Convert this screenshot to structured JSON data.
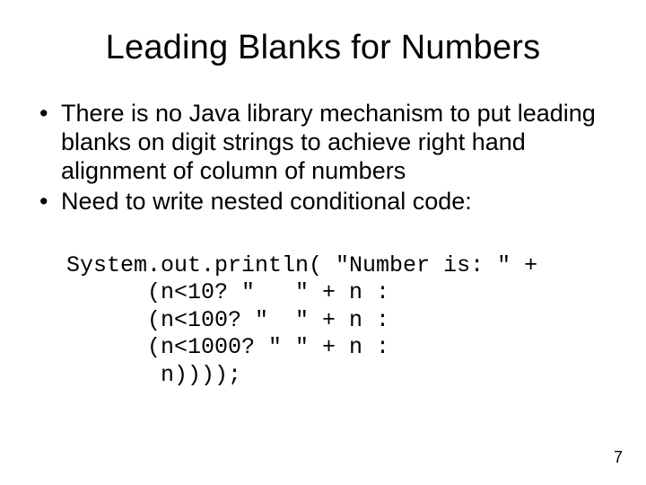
{
  "title": "Leading Blanks for Numbers",
  "bullets": [
    "There is no Java library mechanism to put leading blanks on digit strings to achieve right hand alignment of column of numbers",
    "Need to write nested conditional code:"
  ],
  "code_lines": [
    "System.out.println( \"Number is: \" +",
    "      (n<10? \"   \" + n :",
    "      (n<100? \"  \" + n :",
    "      (n<1000? \" \" + n :",
    "       n))));"
  ],
  "page_number": "7"
}
